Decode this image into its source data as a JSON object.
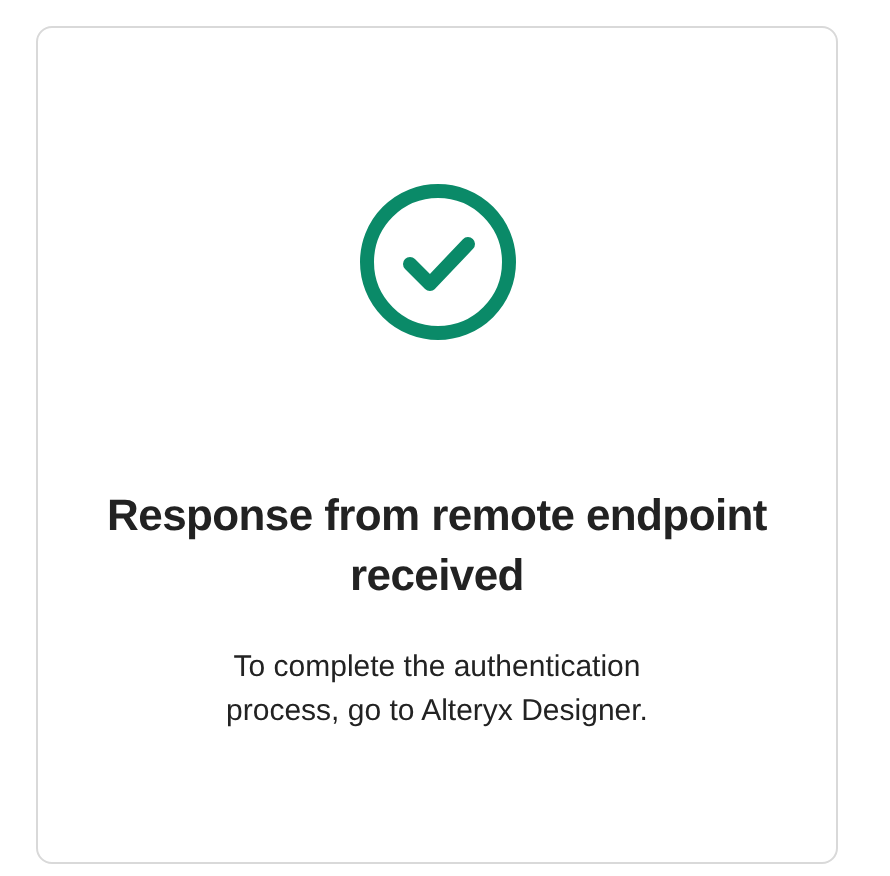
{
  "status": {
    "kind": "success"
  },
  "title": "Response from remote endpoint received",
  "message": "To complete the authentication process, go to Alteryx Designer."
}
